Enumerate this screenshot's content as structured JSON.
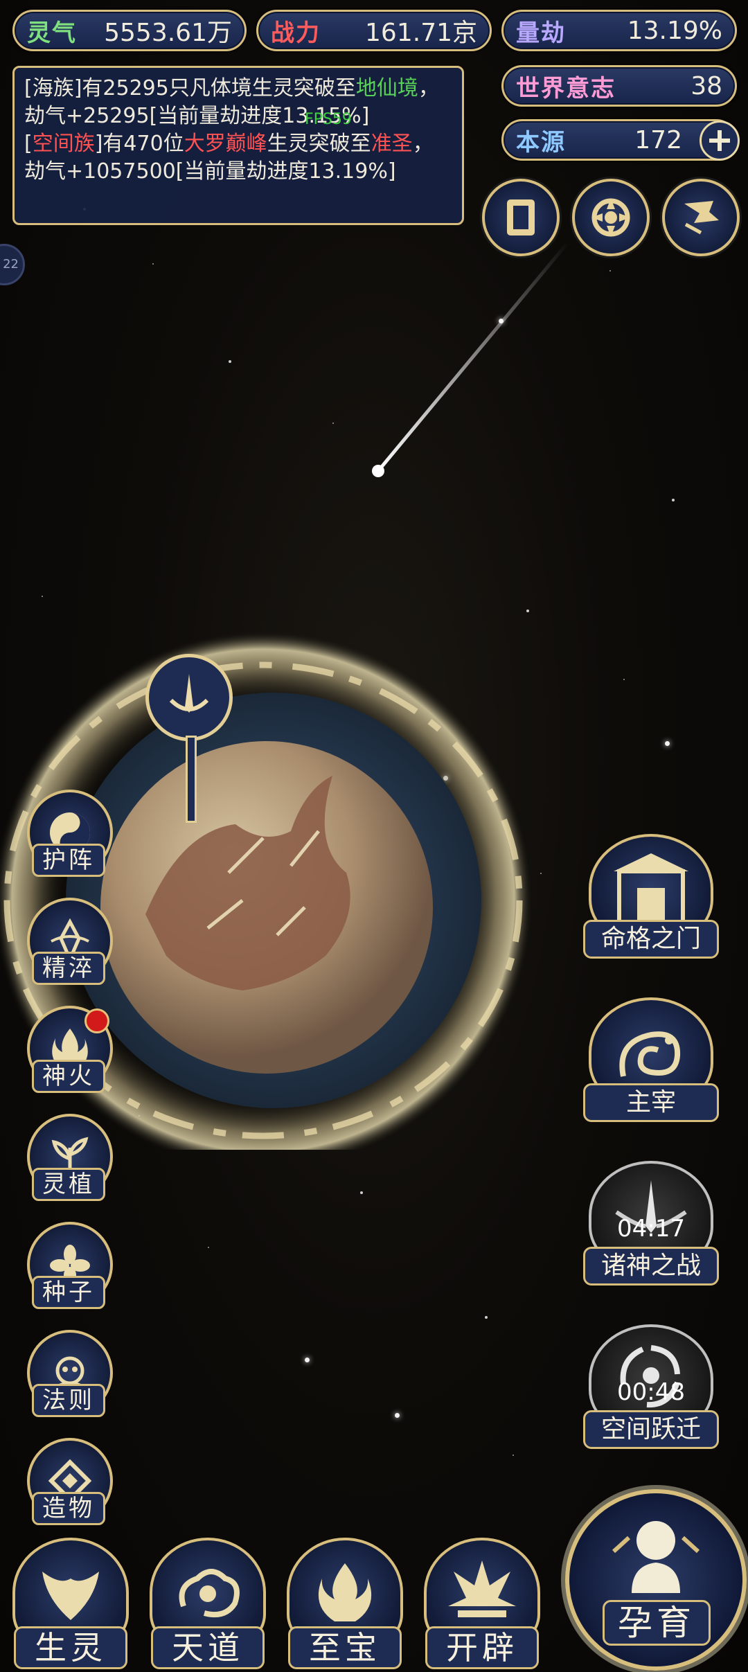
{
  "stats": {
    "lingqi": {
      "label": "灵气",
      "value": "5553.61万"
    },
    "zhanli": {
      "label": "战力",
      "value": "161.71京"
    },
    "liangjie": {
      "label": "量劫",
      "value": "13.19%"
    },
    "shijieyizhi": {
      "label": "世界意志",
      "value": "38"
    },
    "benyuan": {
      "label": "本源",
      "value": "172"
    }
  },
  "log": {
    "line1": {
      "open": "[",
      "tribe": "海族",
      "mid": "]有25295只凡体境生灵突破至",
      "realm": "地仙境",
      "tail": "，劫气+25295[当前量劫进度13.15%]"
    },
    "line2": {
      "open": "[",
      "tribe": "空间族",
      "mid": "]有470位",
      "rank": "大罗巅峰",
      "mid2": "生灵突破至",
      "realm": "准圣",
      "tail": "，劫气+1057500[当前量劫进度13.19%]"
    },
    "fps": "FPS59"
  },
  "side_badge": "22",
  "left_menu": [
    "护阵",
    "精淬",
    "神火",
    "灵植",
    "种子",
    "法则",
    "造物"
  ],
  "right_menu": {
    "mingge": "命格之门",
    "zhuzai": "主宰",
    "zhushen": {
      "label": "诸神之战",
      "timer": "04:17"
    },
    "kongjian": {
      "label": "空间跃迁",
      "timer": "00:48"
    }
  },
  "bottom_menu": [
    "生灵",
    "天道",
    "至宝",
    "开辟"
  ],
  "main_button": "孕育"
}
